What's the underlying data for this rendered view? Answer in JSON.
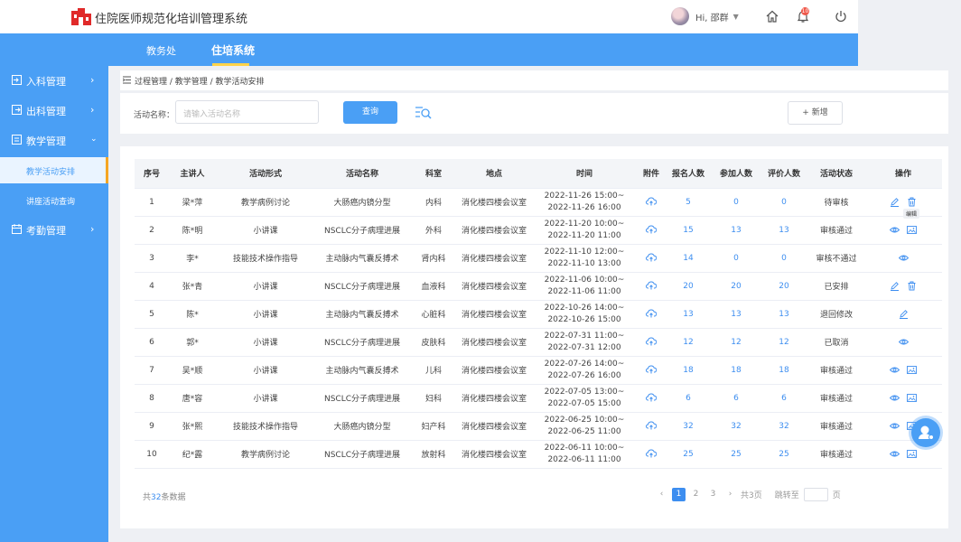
{
  "header": {
    "title": "住院医师规范化培训管理系统",
    "greeting": "Hi, 邵群",
    "notification_count": "10"
  },
  "nav": {
    "tabs": [
      {
        "label": "教务处"
      },
      {
        "label": "住培系统"
      }
    ]
  },
  "sidebar": {
    "items": [
      {
        "label": "入科管理"
      },
      {
        "label": "出科管理"
      },
      {
        "label": "教学管理"
      },
      {
        "label": "考勤管理"
      }
    ],
    "subitems": [
      {
        "label": "教学活动安排"
      },
      {
        "label": "讲座活动查询"
      }
    ]
  },
  "breadcrumb": "过程管理 / 教学管理 / 教学活动安排",
  "search": {
    "label": "活动名称：",
    "placeholder": "请输入活动名称",
    "query_label": "查询",
    "add_label": "+ 新增"
  },
  "table": {
    "headers": [
      "序号",
      "主讲人",
      "活动形式",
      "活动名称",
      "科室",
      "地点",
      "时间",
      "附件",
      "报名人数",
      "参加人数",
      "评价人数",
      "活动状态",
      "操作"
    ],
    "rows": [
      {
        "no": "1",
        "speaker": "梁*萍",
        "form": "教学病例讨论",
        "name": "大肠癌内镜分型",
        "dept": "内科",
        "place": "消化楼四楼会议室",
        "start": "2022-11-26 15:00~",
        "end": "2022-11-26 16:00",
        "signup": "5",
        "attend": "0",
        "review": "0",
        "status": "待审核"
      },
      {
        "no": "2",
        "speaker": "陈*明",
        "form": "小讲课",
        "name": "NSCLC分子病理进展",
        "dept": "外科",
        "place": "消化楼四楼会议室",
        "start": "2022-11-20 10:00~",
        "end": "2022-11-20 11:00",
        "signup": "15",
        "attend": "13",
        "review": "13",
        "status": "审核通过"
      },
      {
        "no": "3",
        "speaker": "李*",
        "form": "技能技术操作指导",
        "name": "主动脉内气囊反搏术",
        "dept": "肾内科",
        "place": "消化楼四楼会议室",
        "start": "2022-11-10 12:00~",
        "end": "2022-11-10 13:00",
        "signup": "14",
        "attend": "0",
        "review": "0",
        "status": "审核不通过"
      },
      {
        "no": "4",
        "speaker": "张*青",
        "form": "小讲课",
        "name": "NSCLC分子病理进展",
        "dept": "血液科",
        "place": "消化楼四楼会议室",
        "start": "2022-11-06 10:00~",
        "end": "2022-11-06 11:00",
        "signup": "20",
        "attend": "20",
        "review": "20",
        "status": "已安排"
      },
      {
        "no": "5",
        "speaker": "陈*",
        "form": "小讲课",
        "name": "主动脉内气囊反搏术",
        "dept": "心脏科",
        "place": "消化楼四楼会议室",
        "start": "2022-10-26 14:00~",
        "end": "2022-10-26 15:00",
        "signup": "13",
        "attend": "13",
        "review": "13",
        "status": "退回修改"
      },
      {
        "no": "6",
        "speaker": "郭*",
        "form": "小讲课",
        "name": "NSCLC分子病理进展",
        "dept": "皮肤科",
        "place": "消化楼四楼会议室",
        "start": "2022-07-31 11:00~",
        "end": "2022-07-31 12:00",
        "signup": "12",
        "attend": "12",
        "review": "12",
        "status": "已取消"
      },
      {
        "no": "7",
        "speaker": "吴*顺",
        "form": "小讲课",
        "name": "主动脉内气囊反搏术",
        "dept": "儿科",
        "place": "消化楼四楼会议室",
        "start": "2022-07-26 14:00~",
        "end": "2022-07-26 16:00",
        "signup": "18",
        "attend": "18",
        "review": "18",
        "status": "审核通过"
      },
      {
        "no": "8",
        "speaker": "唐*容",
        "form": "小讲课",
        "name": "NSCLC分子病理进展",
        "dept": "妇科",
        "place": "消化楼四楼会议室",
        "start": "2022-07-05 13:00~",
        "end": "2022-07-05 15:00",
        "signup": "6",
        "attend": "6",
        "review": "6",
        "status": "审核通过"
      },
      {
        "no": "9",
        "speaker": "张*熙",
        "form": "技能技术操作指导",
        "name": "大肠癌内镜分型",
        "dept": "妇产科",
        "place": "消化楼四楼会议室",
        "start": "2022-06-25 10:00~",
        "end": "2022-06-25 11:00",
        "signup": "32",
        "attend": "32",
        "review": "32",
        "status": "审核通过"
      },
      {
        "no": "10",
        "speaker": "纪*露",
        "form": "教学病例讨论",
        "name": "NSCLC分子病理进展",
        "dept": "放射科",
        "place": "消化楼四楼会议室",
        "start": "2022-06-11 10:00~",
        "end": "2022-06-11 11:00",
        "signup": "25",
        "attend": "25",
        "review": "25",
        "status": "审核通过"
      }
    ],
    "edit_tooltip": "编辑"
  },
  "pagination": {
    "total_prefix": "共",
    "total_count": "32",
    "total_suffix": "条数据",
    "pages": [
      "1",
      "2",
      "3"
    ],
    "page_count_label": "共3页",
    "jump_label": "跳转至",
    "page_unit": "页"
  },
  "colors": {
    "brand": "#4a9ff5",
    "link": "#3d8ef0",
    "active_indicator": "#f5a623",
    "logo": "#e02a2a"
  }
}
